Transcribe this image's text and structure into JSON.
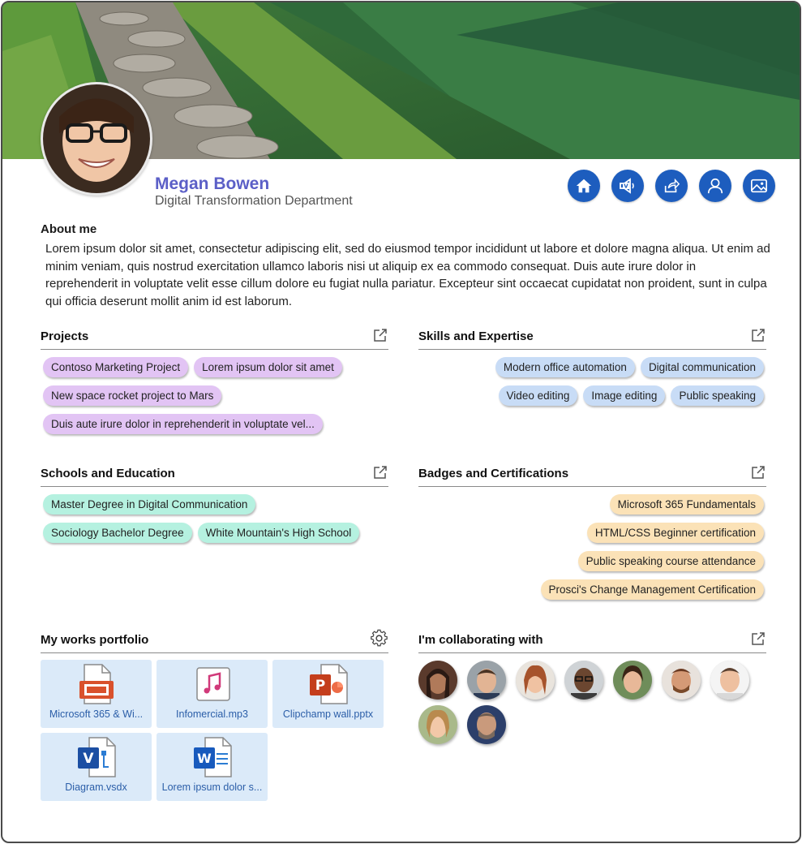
{
  "profile": {
    "name": "Megan Bowen",
    "department": "Digital Transformation Department",
    "avatar_icon": "avatar-photo"
  },
  "actions": [
    {
      "icon": "home-icon"
    },
    {
      "icon": "viva-engage-icon"
    },
    {
      "icon": "share-icon"
    },
    {
      "icon": "person-icon"
    },
    {
      "icon": "image-icon"
    }
  ],
  "about": {
    "title": "About me",
    "text": "Lorem ipsum dolor sit amet, consectetur adipiscing elit, sed do eiusmod tempor incididunt ut labore et dolore magna aliqua. Ut enim ad minim veniam, quis nostrud exercitation ullamco laboris nisi ut aliquip ex ea commodo consequat. Duis aute irure dolor in reprehenderit in voluptate velit esse cillum dolore eu fugiat nulla pariatur. Excepteur sint occaecat cupidatat non proident, sunt in culpa qui officia deserunt mollit anim id est laborum."
  },
  "projects": {
    "title": "Projects",
    "items": [
      "Contoso Marketing Project",
      "Lorem ipsum dolor sit amet",
      "New space rocket project to Mars",
      "Duis aute irure dolor in reprehenderit in voluptate vel..."
    ]
  },
  "skills": {
    "title": "Skills and Expertise",
    "items": [
      "Modern office automation",
      "Digital communication",
      "Video editing",
      "Image editing",
      "Public speaking"
    ]
  },
  "education": {
    "title": "Schools and Education",
    "items": [
      "Master Degree in Digital Communication",
      "Sociology Bachelor Degree",
      "White Mountain's High School"
    ]
  },
  "badges": {
    "title": "Badges and Certifications",
    "items": [
      "Microsoft 365 Fundamentals",
      "HTML/CSS Beginner certification",
      "Public speaking course attendance",
      "Prosci's Change Management Certification"
    ]
  },
  "portfolio": {
    "title": "My works portfolio",
    "files": [
      {
        "name": "Microsoft 365 & Wi...",
        "icon": "video-file-icon"
      },
      {
        "name": "Infomercial.mp3",
        "icon": "audio-file-icon"
      },
      {
        "name": "Clipchamp wall.pptx",
        "icon": "powerpoint-file-icon"
      },
      {
        "name": "Diagram.vsdx",
        "icon": "visio-file-icon"
      },
      {
        "name": "Lorem ipsum dolor s...",
        "icon": "word-file-icon"
      }
    ]
  },
  "collaborators": {
    "title": "I'm collaborating with",
    "count": 9
  },
  "colors": {
    "accent": "#5b5fc7",
    "action_blue": "#1d5dbe",
    "pill_purple": "#e2c4f4",
    "pill_blue": "#c8dcf6",
    "pill_teal": "#b5f1e0",
    "pill_orange": "#fbe2b7",
    "file_tile": "#dbeaf9"
  }
}
